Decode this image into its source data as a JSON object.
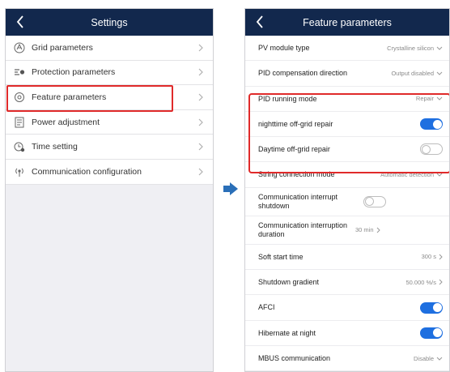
{
  "left": {
    "title": "Settings",
    "items": [
      {
        "label": "Grid parameters",
        "icon": "grid-icon"
      },
      {
        "label": "Protection parameters",
        "icon": "protection-icon"
      },
      {
        "label": "Feature parameters",
        "icon": "feature-gear-icon"
      },
      {
        "label": "Power adjustment",
        "icon": "power-adjust-icon"
      },
      {
        "label": "Time setting",
        "icon": "clock-icon"
      },
      {
        "label": "Communication configuration",
        "icon": "communication-icon"
      }
    ]
  },
  "right": {
    "title": "Feature parameters",
    "items": [
      {
        "label": "PV module type",
        "value": "Crystalline silicon",
        "control": "dropdown"
      },
      {
        "label": "PID compensation direction",
        "value": "Output disabled",
        "control": "dropdown"
      },
      {
        "label": "PID running mode",
        "value": "Repair",
        "control": "dropdown"
      },
      {
        "label": "nighttime off-grid repair",
        "state": "on",
        "control": "toggle"
      },
      {
        "label": "Daytime off-grid repair",
        "state": "off",
        "control": "toggle"
      },
      {
        "label": "String connection mode",
        "value": "Automatic detection",
        "control": "dropdown"
      },
      {
        "label": "Communication interrupt shutdown",
        "state": "off",
        "control": "toggle"
      },
      {
        "label": "Communication interruption duration",
        "value": "30 min",
        "control": "link"
      },
      {
        "label": "Soft start time",
        "value": "300 s",
        "control": "link"
      },
      {
        "label": "Shutdown gradient",
        "value": "50.000 %/s",
        "control": "link"
      },
      {
        "label": "AFCI",
        "state": "on",
        "control": "toggle"
      },
      {
        "label": "Hibernate at night",
        "state": "on",
        "control": "toggle"
      },
      {
        "label": "MBUS communication",
        "value": "Disable",
        "control": "dropdown"
      }
    ]
  },
  "colors": {
    "header": "#12284d",
    "highlight": "#e02a2a",
    "toggle_on": "#1e6fe0",
    "arrow": "#2a6fb8"
  }
}
